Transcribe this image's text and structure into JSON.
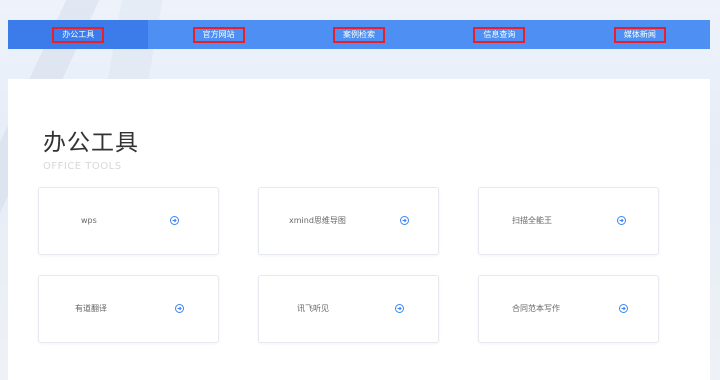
{
  "nav": {
    "items": [
      {
        "label": "办公工具"
      },
      {
        "label": "官方网站"
      },
      {
        "label": "案例检索"
      },
      {
        "label": "信息查询"
      },
      {
        "label": "媒体新闻"
      }
    ]
  },
  "section": {
    "title": "办公工具",
    "subtitle": "OFFICE TOOLS"
  },
  "cards": [
    {
      "label": "wps",
      "icon": "circle-arrow-right-icon"
    },
    {
      "label": "xmind思维导图",
      "icon": "circle-arrow-right-icon"
    },
    {
      "label": "扫描全能王",
      "icon": "circle-arrow-right-icon"
    },
    {
      "label": "有道翻译",
      "icon": "circle-arrow-right-icon"
    },
    {
      "label": "讯飞听见",
      "icon": "circle-arrow-right-icon"
    },
    {
      "label": "合同范本写作",
      "icon": "circle-arrow-right-icon"
    }
  ],
  "colors": {
    "nav_bg": "#4d8ff2",
    "nav_active_bg": "#3b7cea",
    "highlight_border": "#e8202a",
    "icon_blue": "#3d85ee"
  }
}
